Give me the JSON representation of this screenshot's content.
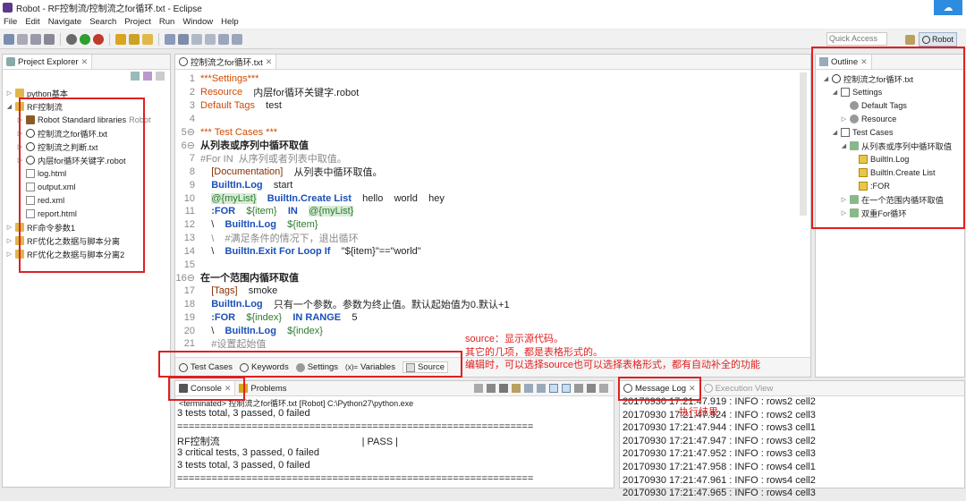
{
  "window": {
    "title": "Robot - RF控制流/控制流之for循环.txt - Eclipse",
    "right_icon": "cloud-icon"
  },
  "menu": [
    "File",
    "Edit",
    "Navigate",
    "Search",
    "Project",
    "Run",
    "Window",
    "Help"
  ],
  "toolbar": {
    "quick_access": "Quick Access",
    "perspective": "Robot"
  },
  "explorer": {
    "tab": "Project Explorer",
    "items": [
      {
        "label": "python基本",
        "depth": 0,
        "arrow": "▷",
        "icon": "folder"
      },
      {
        "label": "RF控制流",
        "depth": 0,
        "arrow": "◢",
        "icon": "folder"
      },
      {
        "label": "Robot Standard libraries",
        "suffix": "Robot",
        "depth": 1,
        "arrow": "▷",
        "icon": "lib"
      },
      {
        "label": "控制流之for循环.txt",
        "depth": 1,
        "arrow": "▷",
        "icon": "robot"
      },
      {
        "label": "控制流之判断.txt",
        "depth": 1,
        "arrow": "▷",
        "icon": "robot"
      },
      {
        "label": "内层for循环关键字.robot",
        "depth": 1,
        "arrow": "▷",
        "icon": "robot"
      },
      {
        "label": "log.html",
        "depth": 1,
        "arrow": "",
        "icon": "html"
      },
      {
        "label": "output.xml",
        "depth": 1,
        "arrow": "",
        "icon": "xml"
      },
      {
        "label": "red.xml",
        "depth": 1,
        "arrow": "",
        "icon": "xml"
      },
      {
        "label": "report.html",
        "depth": 1,
        "arrow": "",
        "icon": "html"
      },
      {
        "label": "RF命令参数1",
        "depth": 0,
        "arrow": "▷",
        "icon": "folder"
      },
      {
        "label": "RF优化之数据与脚本分离",
        "depth": 0,
        "arrow": "▷",
        "icon": "folder"
      },
      {
        "label": "RF优化之数据与脚本分离2",
        "depth": 0,
        "arrow": "▷",
        "icon": "folder"
      }
    ]
  },
  "editor": {
    "tab": "控制流之for循环.txt",
    "lines": [
      {
        "n": "1",
        "segs": [
          {
            "t": "***Settings***",
            "c": "orange"
          }
        ]
      },
      {
        "n": "2",
        "segs": [
          {
            "t": "Resource",
            "c": "orange"
          },
          {
            "t": "    内层for循环关键字.robot",
            "c": ""
          }
        ]
      },
      {
        "n": "3",
        "segs": [
          {
            "t": "Default Tags",
            "c": "orange"
          },
          {
            "t": "    test",
            "c": ""
          }
        ]
      },
      {
        "n": "4",
        "segs": []
      },
      {
        "n": "5⊖",
        "segs": [
          {
            "t": "*** Test Cases ***",
            "c": "orange"
          }
        ]
      },
      {
        "n": "6⊖",
        "segs": [
          {
            "t": "从列表或序列中循环取值",
            "c": "bold"
          }
        ]
      },
      {
        "n": "7",
        "segs": [
          {
            "t": "#For IN  从序列或者列表中取值。",
            "c": "grey"
          }
        ]
      },
      {
        "n": "8",
        "segs": [
          {
            "t": "    [Documentation]",
            "c": "olive"
          },
          {
            "t": "    从列表中循环取值。",
            "c": ""
          }
        ]
      },
      {
        "n": "9",
        "segs": [
          {
            "t": "    BuiltIn.Log",
            "c": "blue"
          },
          {
            "t": "    start",
            "c": ""
          }
        ]
      },
      {
        "n": "10",
        "segs": [
          {
            "t": "    ",
            "c": ""
          },
          {
            "t": "@{myList}",
            "c": "var hl"
          },
          {
            "t": "    BuiltIn.Create List",
            "c": "blue"
          },
          {
            "t": "    hello    world    hey",
            "c": ""
          }
        ]
      },
      {
        "n": "11",
        "segs": [
          {
            "t": "    :FOR",
            "c": "blue"
          },
          {
            "t": "    ${item}",
            "c": "var"
          },
          {
            "t": "    IN",
            "c": "blue"
          },
          {
            "t": "    ",
            "c": ""
          },
          {
            "t": "@{myList}",
            "c": "var hl"
          }
        ]
      },
      {
        "n": "12",
        "segs": [
          {
            "t": "    \\    ",
            "c": ""
          },
          {
            "t": "BuiltIn.Log",
            "c": "blue"
          },
          {
            "t": "    ${item}",
            "c": "var"
          }
        ]
      },
      {
        "n": "13",
        "segs": [
          {
            "t": "    \\    #满足条件的情况下，退出循环",
            "c": "grey"
          }
        ]
      },
      {
        "n": "14",
        "segs": [
          {
            "t": "    \\    ",
            "c": ""
          },
          {
            "t": "BuiltIn.Exit For Loop If",
            "c": "blue"
          },
          {
            "t": "    \"${item}\"==\"world\"",
            "c": ""
          }
        ]
      },
      {
        "n": "15",
        "segs": []
      },
      {
        "n": "16⊖",
        "segs": [
          {
            "t": "在一个范围内循环取值",
            "c": "bold"
          }
        ]
      },
      {
        "n": "17",
        "segs": [
          {
            "t": "    [Tags]",
            "c": "olive"
          },
          {
            "t": "    smoke",
            "c": ""
          }
        ]
      },
      {
        "n": "18",
        "segs": [
          {
            "t": "    BuiltIn.Log",
            "c": "blue"
          },
          {
            "t": "    只有一个参数。参数为终止值。默认起始值为0.默认+1",
            "c": ""
          }
        ]
      },
      {
        "n": "19",
        "segs": [
          {
            "t": "    :FOR",
            "c": "blue"
          },
          {
            "t": "    ${index}",
            "c": "var"
          },
          {
            "t": "    IN RANGE",
            "c": "blue"
          },
          {
            "t": "    5",
            "c": ""
          }
        ]
      },
      {
        "n": "20",
        "segs": [
          {
            "t": "    \\    ",
            "c": ""
          },
          {
            "t": "BuiltIn.Log",
            "c": "blue"
          },
          {
            "t": "    ${index}",
            "c": "var"
          }
        ]
      },
      {
        "n": "21",
        "segs": [
          {
            "t": "    #设置起始值",
            "c": "grey"
          }
        ]
      }
    ],
    "bottom_tabs": [
      "Test Cases",
      "Keywords",
      "Settings",
      "Variables",
      "Source"
    ]
  },
  "annotation": {
    "line1": "source：显示源代码。",
    "line2": "其它的几项，都是表格形式的。",
    "line3": "编辑时，可以选择source也可以选择表格形式，都有自动补全的功能",
    "msglog": "执行结果"
  },
  "outline": {
    "tab": "Outline",
    "items": [
      {
        "label": "控制流之for循环.txt",
        "depth": 0,
        "arrow": "◢",
        "icon": "robot"
      },
      {
        "label": "Settings",
        "depth": 1,
        "arrow": "◢",
        "icon": "table"
      },
      {
        "label": "Default Tags",
        "depth": 2,
        "arrow": "",
        "icon": "gear"
      },
      {
        "label": "Resource",
        "depth": 2,
        "arrow": "▷",
        "icon": "gear"
      },
      {
        "label": "Test Cases",
        "depth": 1,
        "arrow": "◢",
        "icon": "table"
      },
      {
        "label": "从列表或序列中循环取值",
        "depth": 2,
        "arrow": "◢",
        "icon": "flask"
      },
      {
        "label": "BuiltIn.Log",
        "depth": 3,
        "arrow": "",
        "icon": "kw"
      },
      {
        "label": "BuiltIn.Create List",
        "depth": 3,
        "arrow": "",
        "icon": "kw"
      },
      {
        "label": ":FOR",
        "depth": 3,
        "arrow": "",
        "icon": "kw"
      },
      {
        "label": "在一个范围内循环取值",
        "depth": 2,
        "arrow": "▷",
        "icon": "flask"
      },
      {
        "label": "双重For循环",
        "depth": 2,
        "arrow": "▷",
        "icon": "flask"
      }
    ]
  },
  "console": {
    "tabs": [
      "Console",
      "Problems"
    ],
    "header": "<terminated> 控制流之for循环.txt [Robot] C:\\Python27\\python.exe",
    "lines": [
      "3 tests total, 3 passed, 0 failed",
      "==============================================================",
      "RF控制流                                                    | PASS |",
      "3 critical tests, 3 passed, 0 failed",
      "3 tests total, 3 passed, 0 failed",
      "=============================================================="
    ]
  },
  "messagelog": {
    "tabs": [
      "Message Log",
      "Execution View"
    ],
    "lines": [
      "20170930 17:21:47.919 : INFO : rows2 cell2",
      "20170930 17:21:47.924 : INFO : rows2 cell3",
      "20170930 17:21:47.944 : INFO : rows3 cell1",
      "20170930 17:21:47.947 : INFO : rows3 cell2",
      "20170930 17:21:47.952 : INFO : rows3 cell3",
      "20170930 17:21:47.958 : INFO : rows4 cell1",
      "20170930 17:21:47.961 : INFO : rows4 cell2",
      "20170930 17:21:47.965 : INFO : rows4 cell3"
    ]
  }
}
